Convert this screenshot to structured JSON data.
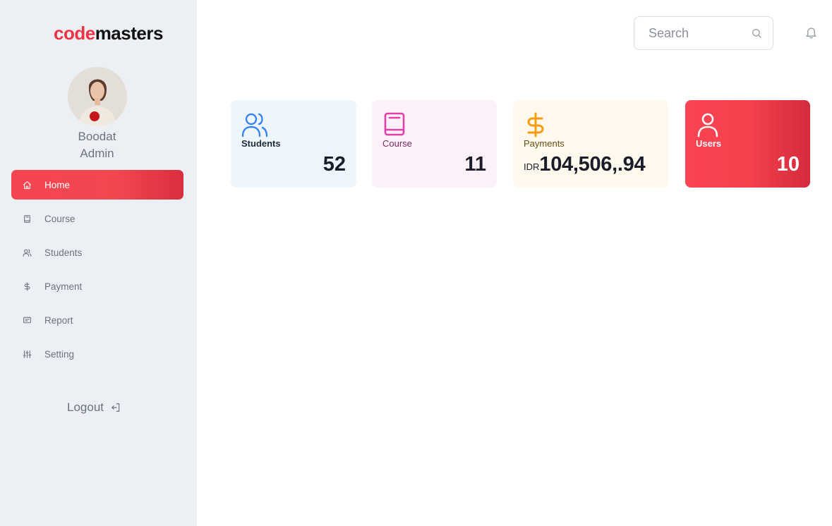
{
  "brand": {
    "part1": "code",
    "part2": "masters"
  },
  "user": {
    "name": "Boodat",
    "role": "Admin"
  },
  "sidebar": {
    "items": [
      {
        "label": "Home",
        "icon": "home-icon",
        "active": true
      },
      {
        "label": "Course",
        "icon": "book-icon",
        "active": false
      },
      {
        "label": "Students",
        "icon": "users-icon",
        "active": false
      },
      {
        "label": "Payment",
        "icon": "dollar-icon",
        "active": false
      },
      {
        "label": "Report",
        "icon": "report-icon",
        "active": false
      },
      {
        "label": "Setting",
        "icon": "sliders-icon",
        "active": false
      }
    ],
    "logout_label": "Logout"
  },
  "header": {
    "search_placeholder": "Search"
  },
  "cards": {
    "students": {
      "label": "Students",
      "value": "52",
      "icon": "users-icon"
    },
    "course": {
      "label": "Course",
      "value": "11",
      "icon": "book-icon"
    },
    "payments": {
      "label": "Payments",
      "currency": "IDR",
      "value": "104,506,.94",
      "icon": "dollar-icon"
    },
    "users": {
      "label": "Users",
      "value": "10",
      "icon": "user-icon"
    }
  },
  "colors": {
    "accent": "#f34750",
    "students_icon": "#3b82f6",
    "course_icon": "#e040a8",
    "payments_icon": "#f59e0b"
  }
}
